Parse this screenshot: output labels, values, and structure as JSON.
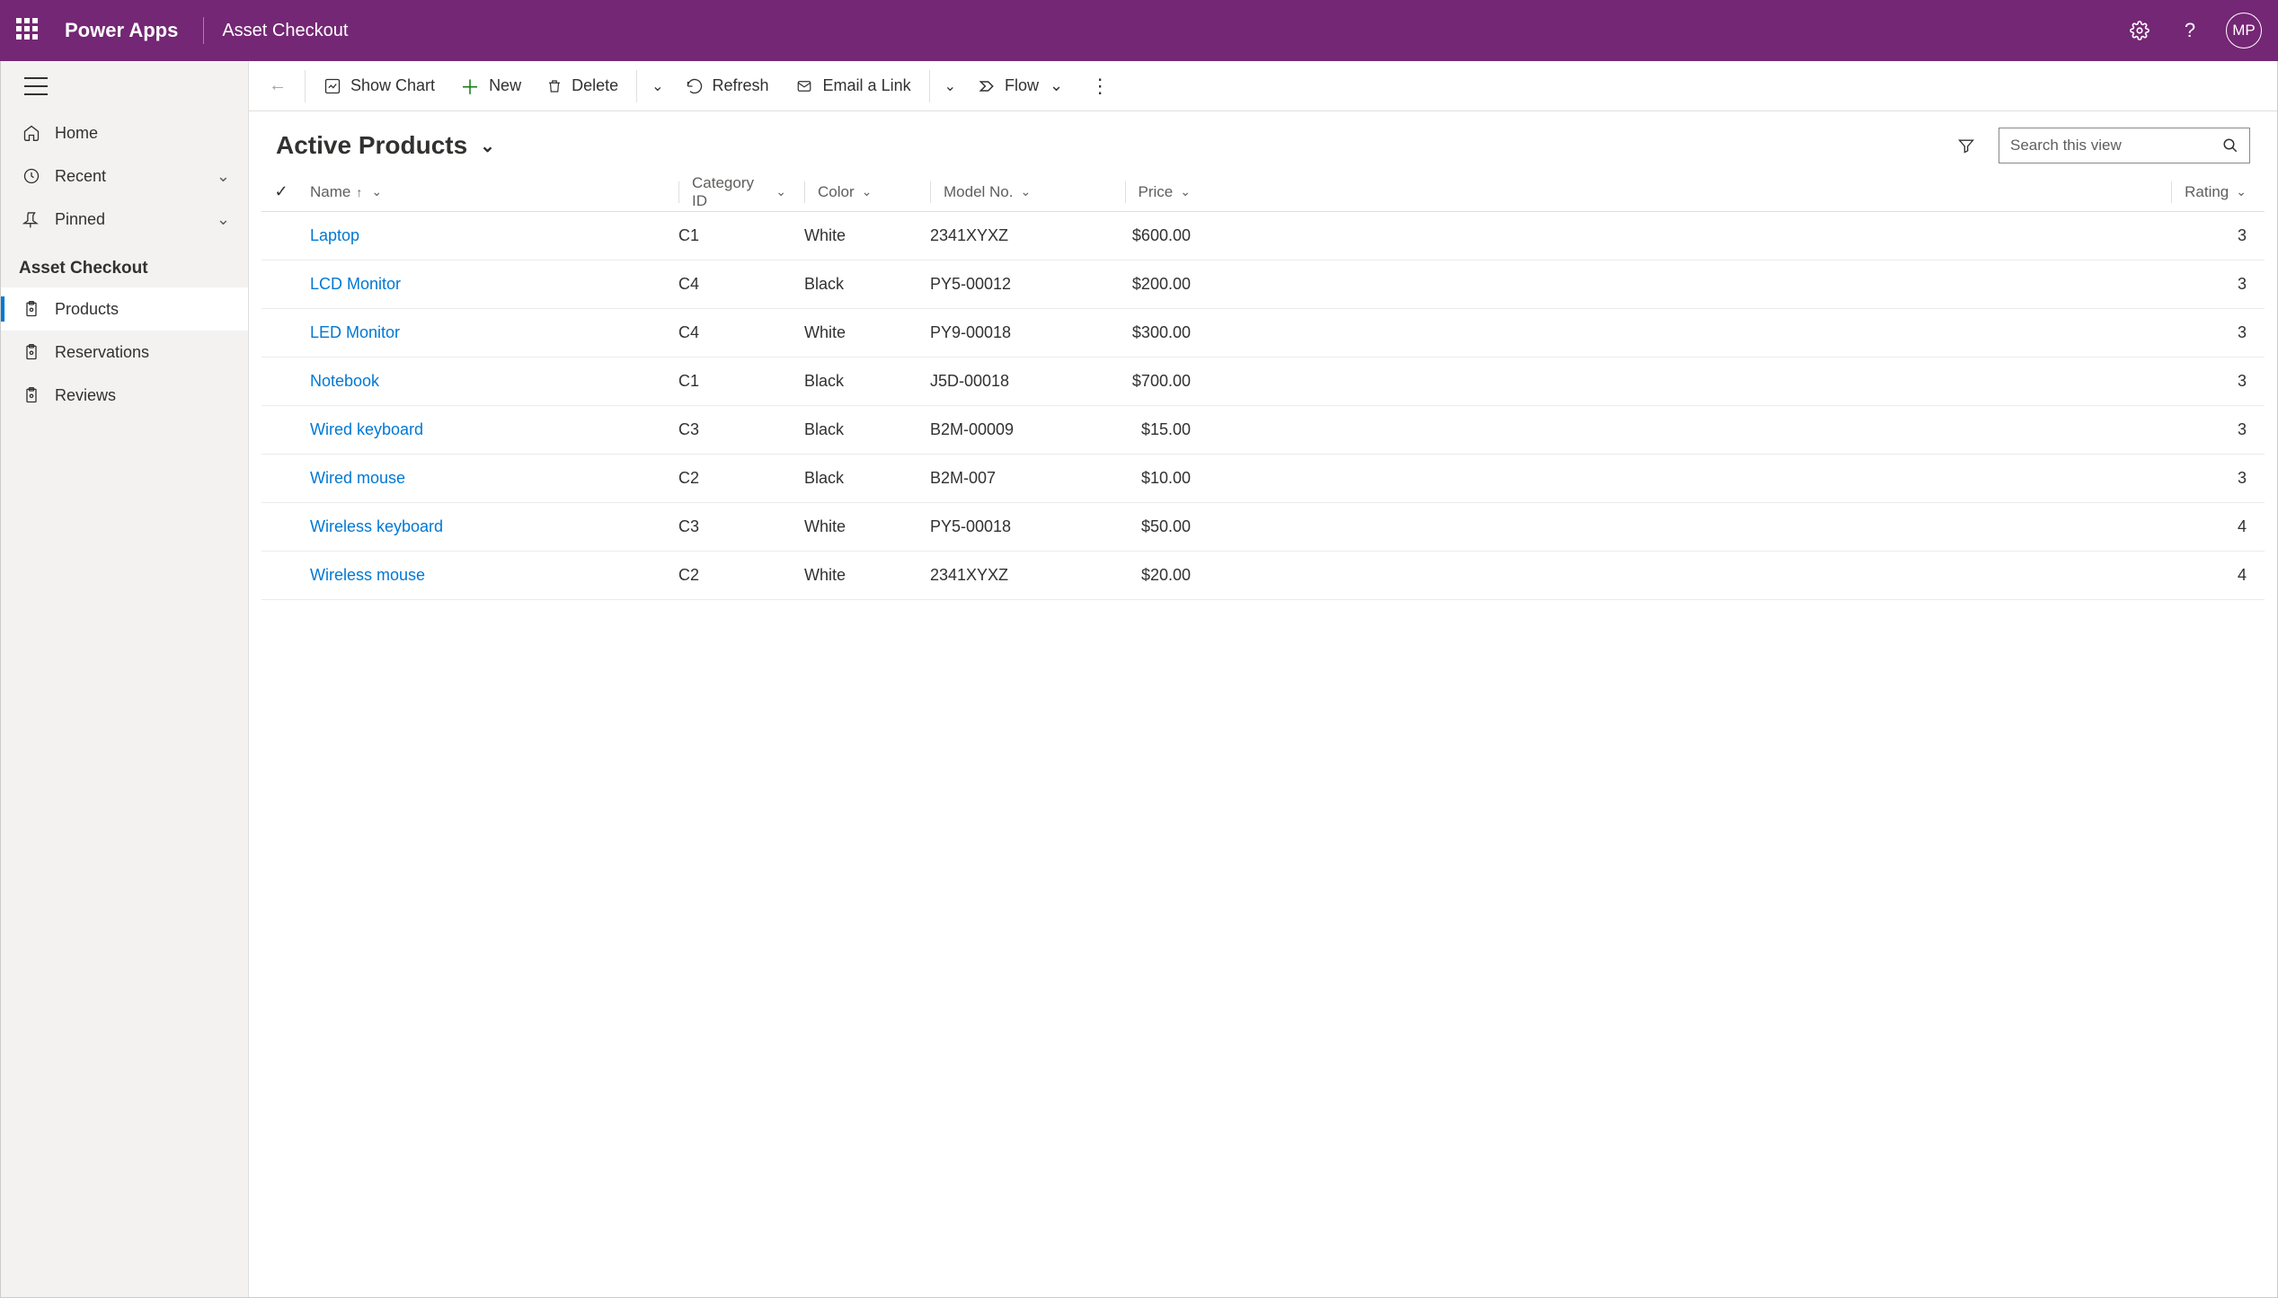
{
  "header": {
    "brand": "Power Apps",
    "app_title": "Asset Checkout",
    "avatar_initials": "MP"
  },
  "sidebar": {
    "home_label": "Home",
    "recent_label": "Recent",
    "pinned_label": "Pinned",
    "section_label": "Asset Checkout",
    "products_label": "Products",
    "reservations_label": "Reservations",
    "reviews_label": "Reviews"
  },
  "commands": {
    "show_chart": "Show Chart",
    "new": "New",
    "delete": "Delete",
    "refresh": "Refresh",
    "email_link": "Email a Link",
    "flow": "Flow"
  },
  "view": {
    "title": "Active Products",
    "search_placeholder": "Search this view"
  },
  "columns": {
    "name": "Name",
    "category": "Category ID",
    "color": "Color",
    "model": "Model No.",
    "price": "Price",
    "rating": "Rating"
  },
  "rows": [
    {
      "name": "Laptop",
      "category": "C1",
      "color": "White",
      "model": "2341XYXZ",
      "price": "$600.00",
      "rating": "3"
    },
    {
      "name": "LCD Monitor",
      "category": "C4",
      "color": "Black",
      "model": "PY5-00012",
      "price": "$200.00",
      "rating": "3"
    },
    {
      "name": "LED Monitor",
      "category": "C4",
      "color": "White",
      "model": "PY9-00018",
      "price": "$300.00",
      "rating": "3"
    },
    {
      "name": "Notebook",
      "category": "C1",
      "color": "Black",
      "model": "J5D-00018",
      "price": "$700.00",
      "rating": "3"
    },
    {
      "name": "Wired keyboard",
      "category": "C3",
      "color": "Black",
      "model": "B2M-00009",
      "price": "$15.00",
      "rating": "3"
    },
    {
      "name": "Wired mouse",
      "category": "C2",
      "color": "Black",
      "model": "B2M-007",
      "price": "$10.00",
      "rating": "3"
    },
    {
      "name": "Wireless keyboard",
      "category": "C3",
      "color": "White",
      "model": "PY5-00018",
      "price": "$50.00",
      "rating": "4"
    },
    {
      "name": "Wireless mouse",
      "category": "C2",
      "color": "White",
      "model": "2341XYXZ",
      "price": "$20.00",
      "rating": "4"
    }
  ]
}
